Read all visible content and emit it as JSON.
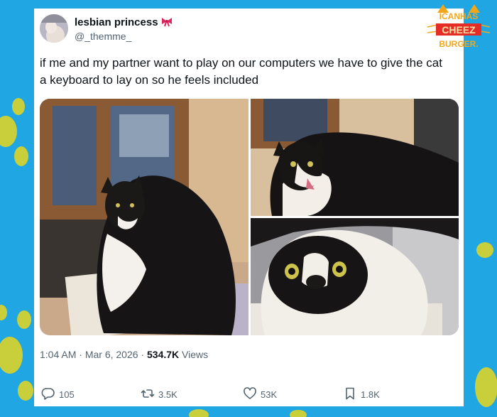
{
  "tweet": {
    "display_name": "lesbian princess",
    "handle": "@_themme_",
    "text": "if me and my partner want to play on our computers we have to give the cat a keyboard to lay on so he feels included",
    "time": "1:04 AM",
    "date": "Mar 6, 2026",
    "views_count": "534.7K",
    "views_label": "Views",
    "separator": "·"
  },
  "actions": {
    "replies": "105",
    "reposts": "3.5K",
    "likes": "53K",
    "bookmarks": "1.8K"
  },
  "logo": {
    "line1": "ICANHAS",
    "line2": "CHEEZ",
    "line3": "BURGER."
  },
  "colors": {
    "background": "#1fa6e3",
    "paw": "#c8cf3a",
    "text_primary": "#0f1419",
    "text_secondary": "#536471"
  }
}
